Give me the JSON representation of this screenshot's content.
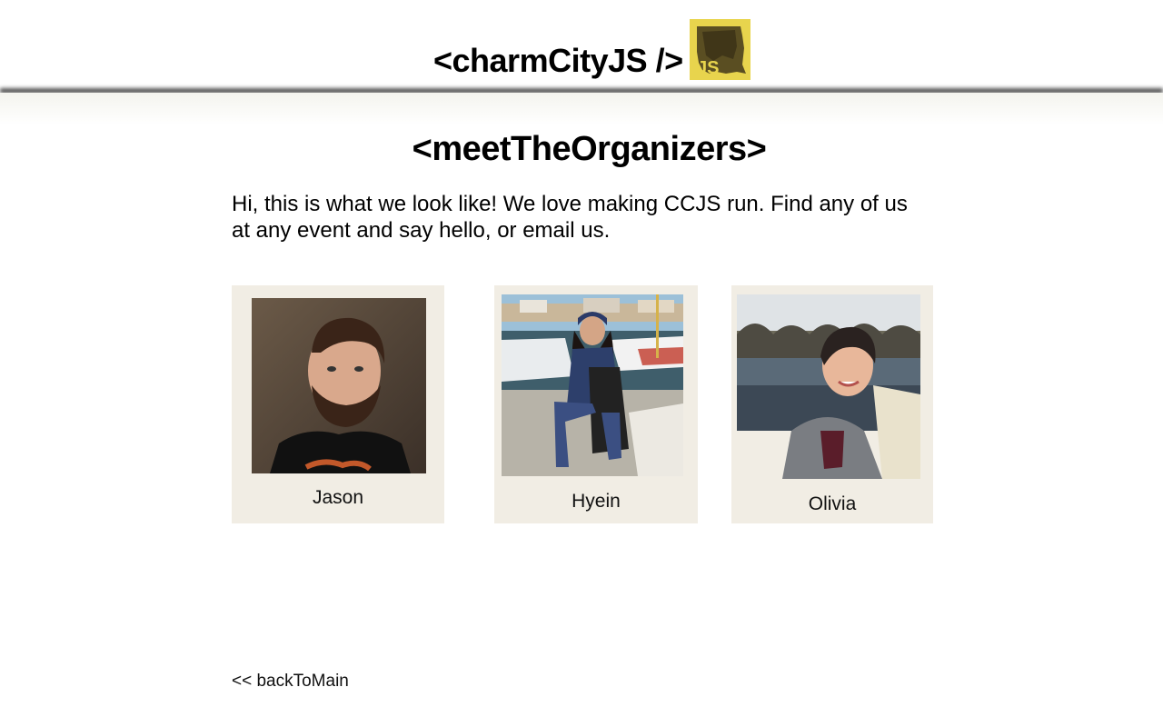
{
  "header": {
    "site_title": "<charmCityJS />",
    "logo_icon": "js-maryland-logo-icon",
    "logo_text": "JS",
    "logo_color": "#e8d44d"
  },
  "main": {
    "heading": "<meetTheOrganizers>",
    "intro": "Hi, this is what we look like! We love making CCJS run. Find any of us at any event and say hello, or email us."
  },
  "organizers": [
    {
      "name": "Jason",
      "photo_icon": "jason-photo"
    },
    {
      "name": "Hyein",
      "photo_icon": "hyein-photo"
    },
    {
      "name": "Olivia",
      "photo_icon": "olivia-photo"
    }
  ],
  "footer": {
    "back_link": "<< backToMain"
  },
  "colors": {
    "card_background": "#f1ede4",
    "header_shadow": "#555555"
  }
}
